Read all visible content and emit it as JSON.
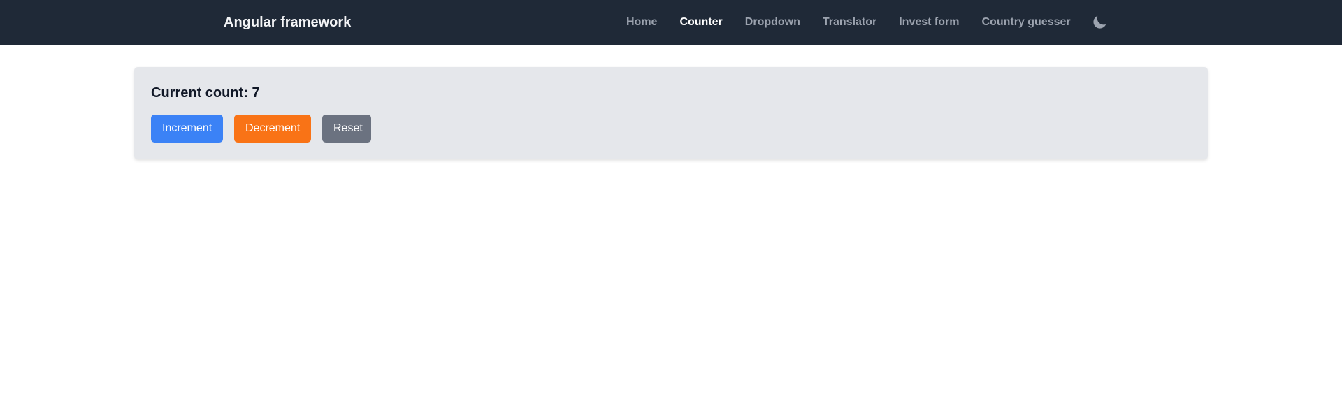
{
  "navbar": {
    "brand": "Angular framework",
    "links": [
      {
        "label": "Home",
        "active": false
      },
      {
        "label": "Counter",
        "active": true
      },
      {
        "label": "Dropdown",
        "active": false
      },
      {
        "label": "Translator",
        "active": false
      },
      {
        "label": "Invest form",
        "active": false
      },
      {
        "label": "Country guesser",
        "active": false
      }
    ],
    "theme_toggle_icon": "moon-icon"
  },
  "counter": {
    "label": "Current count:",
    "value": "7",
    "buttons": {
      "increment": "Increment",
      "decrement": "Decrement",
      "reset": "Reset"
    }
  },
  "colors": {
    "navbar_bg": "#1f2937",
    "card_bg": "#e5e7eb",
    "increment": "#3b82f6",
    "decrement": "#f97316",
    "reset": "#6b7280"
  }
}
